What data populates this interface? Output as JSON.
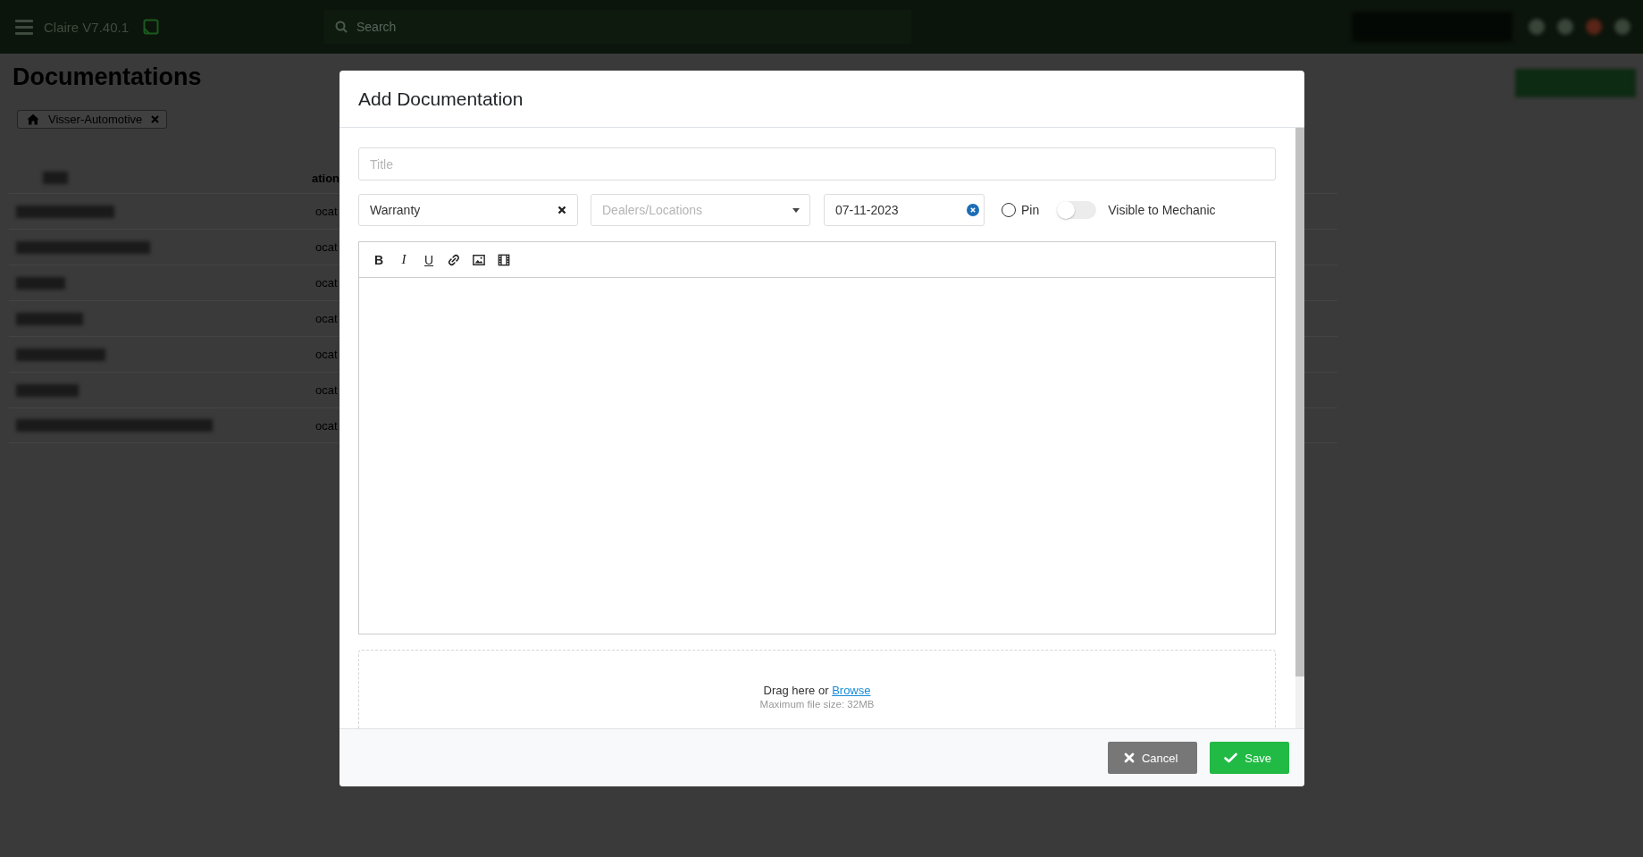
{
  "top_bar": {
    "app_name": "Claire V7.40.1",
    "search": {
      "placeholder": "Search"
    }
  },
  "page": {
    "title": "Documentations",
    "filter_chip": {
      "label": "Visser-Automotive"
    }
  },
  "table": {
    "columns": [
      {
        "label": "ation"
      }
    ],
    "rows": [
      {
        "cell": "ocat"
      },
      {
        "cell": "ocat"
      },
      {
        "cell": "ocat"
      },
      {
        "cell": "ocat"
      },
      {
        "cell": "ocat"
      },
      {
        "cell": "ocat"
      },
      {
        "cell": "ocat"
      }
    ]
  },
  "dialog": {
    "title": "Add Documentation",
    "title_field": {
      "placeholder": "Title"
    },
    "type_select": {
      "value": "Warranty"
    },
    "location_select": {
      "placeholder": "Dealers/Locations"
    },
    "date_field": {
      "value": "07-11-2023"
    },
    "pin": {
      "label": "Pin",
      "checked": false
    },
    "visible_to_mechanic": {
      "label": "Visible to Mechanic",
      "on": false
    },
    "editor_toolbar": [
      {
        "kind": "bold",
        "label": "B"
      },
      {
        "kind": "italic",
        "label": "I"
      },
      {
        "kind": "underline",
        "label": "U"
      },
      {
        "kind": "link"
      },
      {
        "kind": "image"
      },
      {
        "kind": "video"
      }
    ],
    "dropzone": {
      "prompt": "Drag here or",
      "link": "Browse",
      "hint": "Maximum file size: 32MB"
    },
    "buttons": [
      {
        "kind": "cancel",
        "label": "Cancel"
      },
      {
        "kind": "save",
        "label": "Save"
      }
    ]
  }
}
